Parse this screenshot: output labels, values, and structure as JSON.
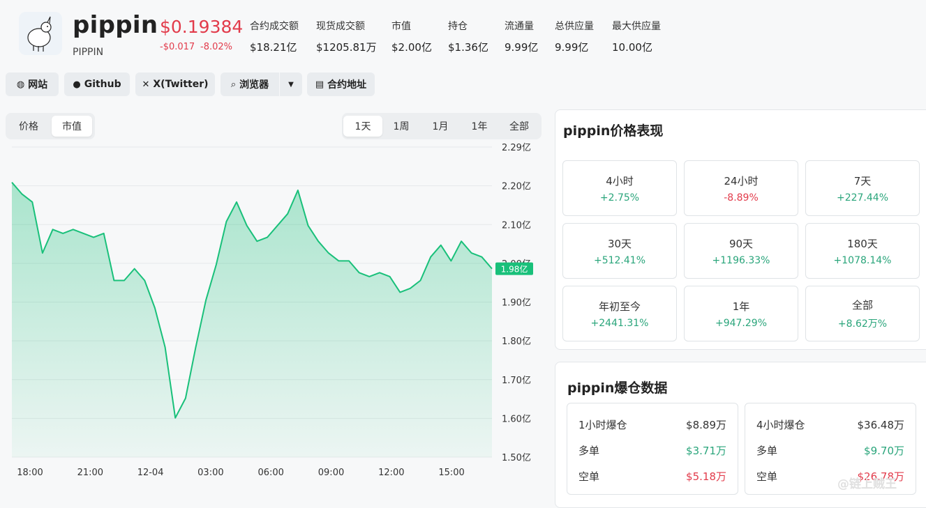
{
  "coin": {
    "name": "pippin",
    "symbol": "PIPPIN",
    "price": "$0.19384",
    "change_abs": "-$0.017",
    "change_pct": "-8.02%"
  },
  "stats": [
    {
      "label": "合约成交额",
      "value": "$18.21亿"
    },
    {
      "label": "现货成交额",
      "value": "$1205.81万"
    },
    {
      "label": "市值",
      "value": "$2.00亿"
    },
    {
      "label": "持仓",
      "value": "$1.36亿"
    },
    {
      "label": "流通量",
      "value": "9.99亿"
    },
    {
      "label": "总供应量",
      "value": "9.99亿"
    },
    {
      "label": "最大供应量",
      "value": "10.00亿"
    }
  ],
  "links": {
    "website": "网站",
    "github": "Github",
    "twitter": "X(Twitter)",
    "explorer": "浏览器",
    "contract": "合约地址"
  },
  "chart_tabs": {
    "price": "价格",
    "mcap": "市值"
  },
  "ranges": [
    "1天",
    "1周",
    "1月",
    "1年",
    "全部"
  ],
  "current_marker": "1.98亿",
  "colors": {
    "up": "#2aa57b",
    "down": "#e23b4b",
    "line": "#19c07a"
  },
  "chart_data": {
    "type": "area",
    "title": "",
    "unit": "亿",
    "x_ticks": [
      "18:00",
      "21:00",
      "12-04",
      "03:00",
      "06:00",
      "09:00",
      "12:00",
      "15:00"
    ],
    "y_ticks": [
      "2.29亿",
      "2.20亿",
      "2.10亿",
      "2.00亿",
      "1.90亿",
      "1.80亿",
      "1.70亿",
      "1.60亿",
      "1.50亿"
    ],
    "ylim": [
      1.5,
      2.29
    ],
    "grid": true,
    "x": [
      "17:00",
      "17:30",
      "18:00",
      "18:30",
      "19:00",
      "19:30",
      "20:00",
      "20:30",
      "21:00",
      "21:30",
      "22:00",
      "22:30",
      "23:00",
      "23:30",
      "00:00",
      "00:30",
      "01:00",
      "01:30",
      "02:00",
      "02:30",
      "03:00",
      "03:30",
      "04:00",
      "04:30",
      "05:00",
      "05:30",
      "06:00",
      "06:30",
      "07:00",
      "07:30",
      "08:00",
      "08:30",
      "09:00",
      "09:30",
      "10:00",
      "10:30",
      "11:00",
      "11:30",
      "12:00",
      "12:30",
      "13:00",
      "13:30",
      "14:00",
      "14:30",
      "15:00",
      "15:30",
      "16:00",
      "16:30"
    ],
    "values": [
      2.2,
      2.17,
      2.15,
      2.02,
      2.08,
      2.07,
      2.08,
      2.07,
      2.06,
      2.07,
      1.95,
      1.95,
      1.98,
      1.95,
      1.88,
      1.78,
      1.6,
      1.65,
      1.78,
      1.9,
      1.99,
      2.1,
      2.15,
      2.09,
      2.05,
      2.06,
      2.09,
      2.12,
      2.18,
      2.09,
      2.05,
      2.02,
      2.0,
      2.0,
      1.97,
      1.96,
      1.97,
      1.96,
      1.92,
      1.93,
      1.95,
      2.01,
      2.04,
      2.0,
      2.05,
      2.02,
      2.01,
      1.98
    ]
  },
  "performance": {
    "title": "pippin价格表现",
    "items": [
      {
        "label": "4小时",
        "value": "+2.75%",
        "dir": "up"
      },
      {
        "label": "24小时",
        "value": "-8.89%",
        "dir": "down"
      },
      {
        "label": "7天",
        "value": "+227.44%",
        "dir": "up"
      },
      {
        "label": "30天",
        "value": "+512.41%",
        "dir": "up"
      },
      {
        "label": "90天",
        "value": "+1196.33%",
        "dir": "up"
      },
      {
        "label": "180天",
        "value": "+1078.14%",
        "dir": "up"
      },
      {
        "label": "年初至今",
        "value": "+2441.31%",
        "dir": "up"
      },
      {
        "label": "1年",
        "value": "+947.29%",
        "dir": "up"
      },
      {
        "label": "全部",
        "value": "+8.62万%",
        "dir": "up"
      }
    ]
  },
  "liquidation": {
    "title": "pippin爆仓数据",
    "boxes": [
      {
        "label": "1小时爆仓",
        "total": "$8.89万",
        "long_label": "多单",
        "long": "$3.71万",
        "short_label": "空单",
        "short": "$5.18万"
      },
      {
        "label": "4小时爆仓",
        "total": "$36.48万",
        "long_label": "多单",
        "long": "$9.70万",
        "short_label": "空单",
        "short": "$26.78万"
      }
    ]
  },
  "watermark": "@链上贼王"
}
